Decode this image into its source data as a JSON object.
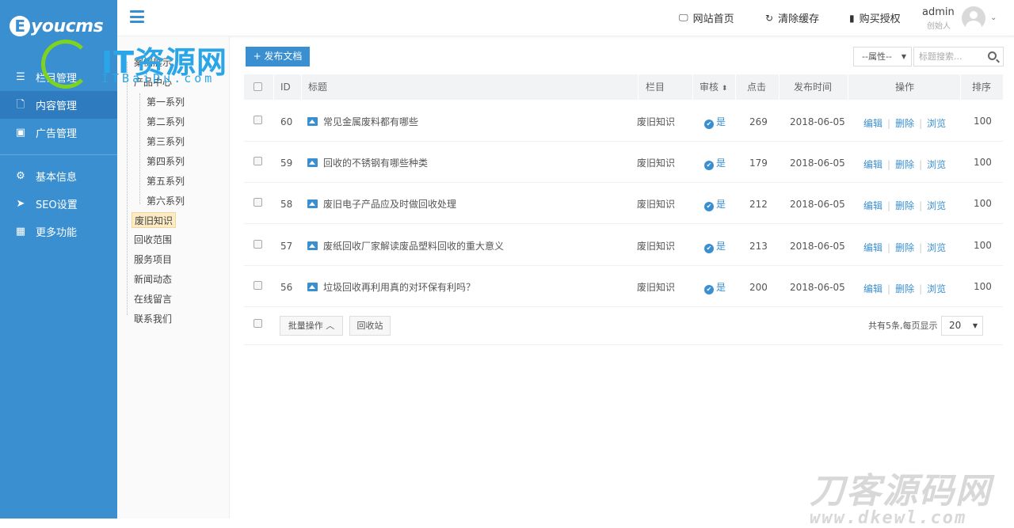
{
  "app": {
    "logo_text": "youcms",
    "logo_letter": "E"
  },
  "sidebar": {
    "items": [
      {
        "label": "栏目管理",
        "icon": "list-icon"
      },
      {
        "label": "内容管理",
        "icon": "document-icon"
      },
      {
        "label": "广告管理",
        "icon": "image-icon"
      },
      {
        "label": "基本信息",
        "icon": "gear-icon"
      },
      {
        "label": "SEO设置",
        "icon": "send-icon"
      },
      {
        "label": "更多功能",
        "icon": "grid-icon"
      }
    ]
  },
  "header": {
    "links": [
      {
        "label": "网站首页",
        "icon": "monitor-icon"
      },
      {
        "label": "清除缓存",
        "icon": "refresh-icon"
      },
      {
        "label": "购买授权",
        "icon": "bookmark-icon"
      }
    ],
    "user_name": "admin",
    "user_role": "创始人"
  },
  "tree": {
    "items": [
      {
        "label": "案例展示"
      },
      {
        "label": "产品中心"
      },
      {
        "label": "第一系列"
      },
      {
        "label": "第二系列"
      },
      {
        "label": "第三系列"
      },
      {
        "label": "第四系列"
      },
      {
        "label": "第五系列"
      },
      {
        "label": "第六系列"
      },
      {
        "label": "废旧知识"
      },
      {
        "label": "回收范围"
      },
      {
        "label": "服务项目"
      },
      {
        "label": "新闻动态"
      },
      {
        "label": "在线留言"
      },
      {
        "label": "联系我们"
      }
    ],
    "selected": "废旧知识"
  },
  "toolbar": {
    "publish_label": "+ 发布文档",
    "attr_select": "--属性--",
    "search_placeholder": "标题搜索..."
  },
  "table": {
    "headers": {
      "id": "ID",
      "title": "标题",
      "column": "栏目",
      "audit": "审核",
      "clicks": "点击",
      "date": "发布时间",
      "ops": "操作",
      "sort": "排序"
    },
    "rows": [
      {
        "id": "60",
        "title": "常见金属废料都有哪些",
        "column": "废旧知识",
        "audit": "是",
        "clicks": "269",
        "date": "2018-06-05",
        "sort": "100"
      },
      {
        "id": "59",
        "title": "回收的不锈钢有哪些种类",
        "column": "废旧知识",
        "audit": "是",
        "clicks": "179",
        "date": "2018-06-05",
        "sort": "100"
      },
      {
        "id": "58",
        "title": "废旧电子产品应及时做回收处理",
        "column": "废旧知识",
        "audit": "是",
        "clicks": "212",
        "date": "2018-06-05",
        "sort": "100"
      },
      {
        "id": "57",
        "title": "废纸回收厂家解读废品塑料回收的重大意义",
        "column": "废旧知识",
        "audit": "是",
        "clicks": "213",
        "date": "2018-06-05",
        "sort": "100"
      },
      {
        "id": "56",
        "title": "垃圾回收再利用真的对环保有利吗？",
        "column": "废旧知识",
        "audit": "是",
        "clicks": "200",
        "date": "2018-06-05",
        "sort": "100"
      }
    ],
    "ops": {
      "edit": "编辑",
      "delete": "删除",
      "view": "浏览"
    }
  },
  "footer": {
    "batch_label": "批量操作 ︿",
    "recycle_label": "回收站",
    "total_text": "共有5条,每页显示",
    "page_size": "20"
  },
  "watermarks": {
    "top_text": "IT资源网",
    "top_sub": "ITBaiDu.com",
    "bottom_text": "刀客源码网",
    "bottom_sub": "www.dkewl.com"
  },
  "colors": {
    "brand": "#3a8fd0",
    "sidebar_active": "#2e7cbf",
    "selected_tree": "#fcebc4"
  }
}
